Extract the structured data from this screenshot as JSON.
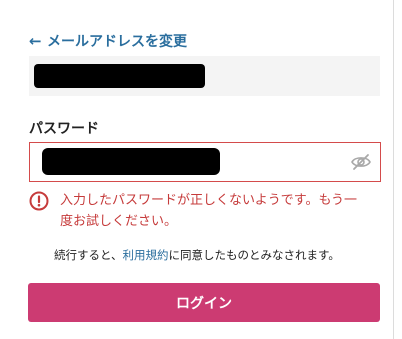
{
  "header": {
    "back_link_label": "メールアドレスを変更",
    "back_icon": "arrow-left-icon"
  },
  "email": {
    "value": ""
  },
  "password": {
    "label": "パスワード",
    "value": "",
    "toggle_icon": "eye-slash-icon"
  },
  "error": {
    "icon": "alert-circle-icon",
    "message": "入力したパスワードが正しくないようです。もう一度お試しください。"
  },
  "terms": {
    "prefix": "続行すると、",
    "link": "利用規約",
    "suffix": "に同意したものとみなされます。"
  },
  "login_button": {
    "label": "ログイン"
  },
  "colors": {
    "link": "#2a6e9e",
    "error": "#c63b3b",
    "primary": "#cc3b72",
    "field_background": "#f4f4f4"
  }
}
